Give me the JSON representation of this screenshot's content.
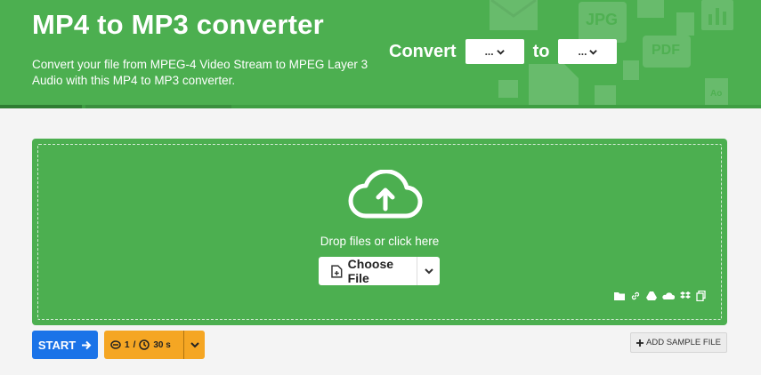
{
  "header": {
    "title": "MP4 to MP3 converter",
    "description": "Convert your file from MPEG-4 Video Stream to MPEG Layer 3 Audio with this MP4 to MP3 converter.",
    "convert_label": "Convert",
    "to_label": "to",
    "from_select_value": "...",
    "to_select_value": "..."
  },
  "decor_icons": [
    "mail-icon",
    "jpg-file-icon",
    "image-file-icon",
    "chart-file-icon",
    "pdf-file-icon",
    "document-file-icon",
    "audio-file-icon"
  ],
  "decor_labels": {
    "jpg": "JPG",
    "pdf": "PDF",
    "ao": "Ao"
  },
  "dropzone": {
    "drop_text": "Drop files or click here",
    "choose_label": "Choose File",
    "sources": [
      "folder-icon",
      "link-icon",
      "google-drive-icon",
      "onedrive-icon",
      "dropbox-icon",
      "clipboard-icon"
    ]
  },
  "actions": {
    "start_label": "START",
    "file_limit": "1",
    "separator": "/",
    "time_limit": "30 s",
    "sample_label": "ADD SAMPLE FILE"
  },
  "colors": {
    "brand_green": "#4caf50",
    "start_blue": "#1a73e8",
    "limit_orange": "#f5a623",
    "page_bg": "#f4f4f4"
  }
}
